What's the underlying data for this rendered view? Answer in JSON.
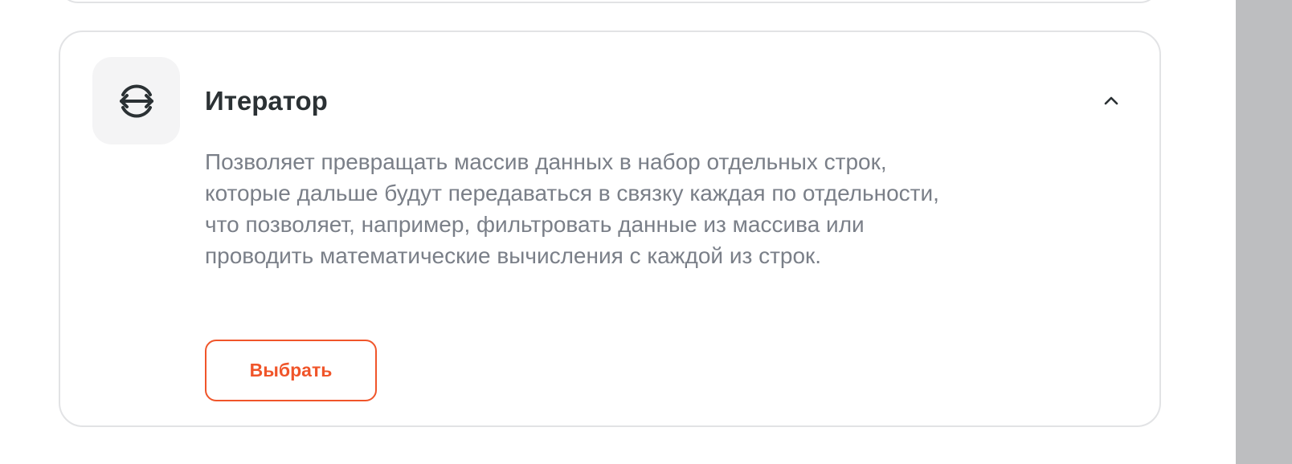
{
  "card": {
    "title": "Итератор",
    "description": "Позволяет превращать массив данных в набор отдельных строк, которые дальше будут передаваться в связку каждая по отдельности, что позволяет, например, фильтровать данные из массива или проводить математические вычисления с каждой из строк.",
    "button_label": "Выбрать",
    "icon": "iterator-icon",
    "expanded": true
  },
  "colors": {
    "accent": "#f0552a",
    "title": "#2b3134",
    "description": "#7a7f88",
    "border": "#e2e3e5",
    "icon_tile": "#f4f4f5",
    "scrollbar": "#bdbec0"
  }
}
